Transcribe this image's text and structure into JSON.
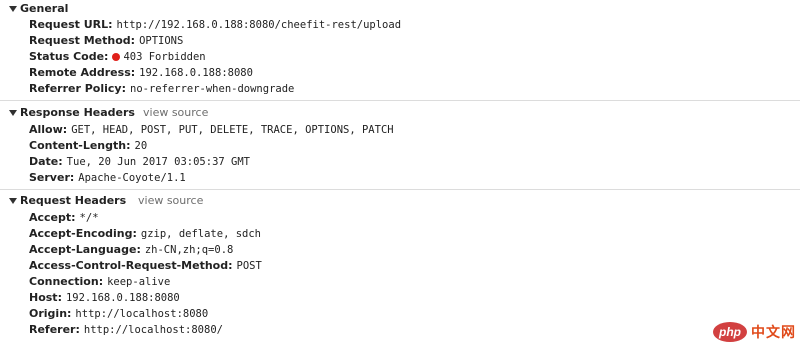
{
  "general": {
    "title": "General",
    "rows": [
      {
        "key": "Request URL:",
        "value": "http://192.168.0.188:8080/cheefit-rest/upload"
      },
      {
        "key": "Request Method:",
        "value": "OPTIONS"
      },
      {
        "key": "Status Code:",
        "value": "403 Forbidden"
      },
      {
        "key": "Remote Address:",
        "value": "192.168.0.188:8080"
      },
      {
        "key": "Referrer Policy:",
        "value": "no-referrer-when-downgrade"
      }
    ]
  },
  "response_headers": {
    "title": "Response Headers",
    "view_source": "view source",
    "rows": [
      {
        "key": "Allow:",
        "value": "GET, HEAD, POST, PUT, DELETE, TRACE, OPTIONS, PATCH"
      },
      {
        "key": "Content-Length:",
        "value": "20"
      },
      {
        "key": "Date:",
        "value": "Tue, 20 Jun 2017 03:05:37 GMT"
      },
      {
        "key": "Server:",
        "value": "Apache-Coyote/1.1"
      }
    ]
  },
  "request_headers": {
    "title": "Request Headers",
    "view_source": "view source",
    "rows": [
      {
        "key": "Accept:",
        "value": "*/*"
      },
      {
        "key": "Accept-Encoding:",
        "value": "gzip, deflate, sdch"
      },
      {
        "key": "Accept-Language:",
        "value": "zh-CN,zh;q=0.8"
      },
      {
        "key": "Access-Control-Request-Method:",
        "value": "POST"
      },
      {
        "key": "Connection:",
        "value": "keep-alive"
      },
      {
        "key": "Host:",
        "value": "192.168.0.188:8080"
      },
      {
        "key": "Origin:",
        "value": "http://localhost:8080"
      },
      {
        "key": "Referer:",
        "value": "http://localhost:8080/"
      }
    ]
  },
  "watermark": {
    "badge": "php",
    "text": "中文网"
  },
  "colors": {
    "status_error": "#e0201a",
    "view_source": "#6e6e6e",
    "divider": "#dcdcdc"
  }
}
